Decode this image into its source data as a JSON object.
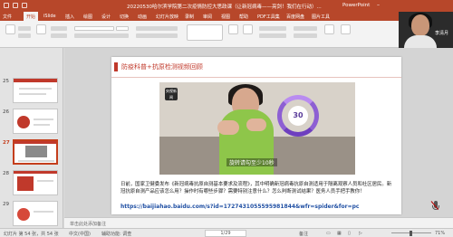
{
  "window": {
    "doc_title": "20220530哈尔滨学院第二次疫情防控大思政课（让新冠病毒——亮剑！我们在行动）...",
    "app_name": "PowerPoint"
  },
  "ribbon": {
    "tabs": [
      "文件",
      "开始",
      "iSlide",
      "插入",
      "绘图",
      "设计",
      "切换",
      "动画",
      "幻灯片放映",
      "录制",
      "审阅",
      "视图",
      "帮助",
      "PDF工具集",
      "百度网盘",
      "图片工具"
    ],
    "active_tab": "开始"
  },
  "webcam": {
    "name": "李清月"
  },
  "thumbnails": [
    {
      "num": "25",
      "selected": false
    },
    {
      "num": "26",
      "selected": false
    },
    {
      "num": "27",
      "selected": true
    },
    {
      "num": "28",
      "selected": false
    },
    {
      "num": "29",
      "selected": false
    }
  ],
  "slide": {
    "title": "防疫科普+抗原检测视频回顾",
    "video": {
      "logo": "央视新闻",
      "timer": "30",
      "subtitle": "旋转请勾至少10秒"
    },
    "body": "日前，国家卫健委发布《新冠病毒抗原自测基本要求及流程》，其中明确新冠病毒抗原自测适用于隔离观察人员和社区居民。新冠抗原自测产品应该怎么用？操作时有哪些步骤？需要特别注意什么？怎么判断测试结果？医务人员手把手教你！",
    "url": "https://baijiahao.baidu.com/s?id=1727431055595981844&wfr=spider&for=pc"
  },
  "notes": {
    "placeholder": "单击此处添加备注"
  },
  "status": {
    "slide_info": "幻灯片 第 54 张，共 54 张",
    "language": "中文(中国)",
    "accessibility": "辅助功能: 调查",
    "pager": "1/29",
    "notes_btn": "备注",
    "zoom": "71%"
  },
  "colors": {
    "accent": "#b7472a",
    "slide_red": "#c0392b",
    "url_blue": "#1f4fa3"
  }
}
